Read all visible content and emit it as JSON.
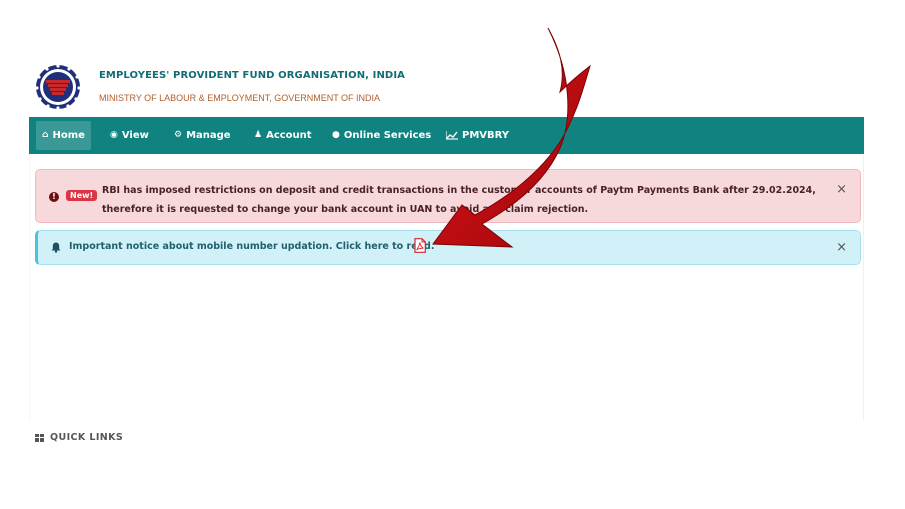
{
  "header": {
    "org_title": "EMPLOYEES' PROVIDENT FUND ORGANISATION, INDIA",
    "org_subtitle": "MINISTRY OF LABOUR & EMPLOYMENT, GOVERNMENT OF INDIA"
  },
  "nav": {
    "items": [
      {
        "label": "Home",
        "icon": "home-icon"
      },
      {
        "label": "View",
        "icon": "eye-icon"
      },
      {
        "label": "Manage",
        "icon": "gears-icon"
      },
      {
        "label": "Account",
        "icon": "user-icon"
      },
      {
        "label": "Online Services",
        "icon": "globe-icon"
      },
      {
        "label": "PMVBRY",
        "icon": "line-chart-icon"
      }
    ],
    "active": "Home"
  },
  "alerts": {
    "danger": {
      "badge": "New!",
      "text": "RBI has imposed restrictions on deposit and credit transactions in the customer accounts of Paytm Payments Bank after 29.02.2024, therefore it is requested to change your bank account in UAN to avoid any claim rejection.",
      "close": "×"
    },
    "info": {
      "text": "Important notice about mobile number updation. Click here to read.",
      "close": "×"
    }
  },
  "quick_links": {
    "label": "QUICK LINKS"
  },
  "colors": {
    "nav_bg": "#108381",
    "title_teal": "#0f6e73",
    "subtitle_orange": "#b0602e",
    "danger_bg": "#f8d9db",
    "info_bg": "#d0f1f8",
    "arrow_red": "#c0080d"
  }
}
